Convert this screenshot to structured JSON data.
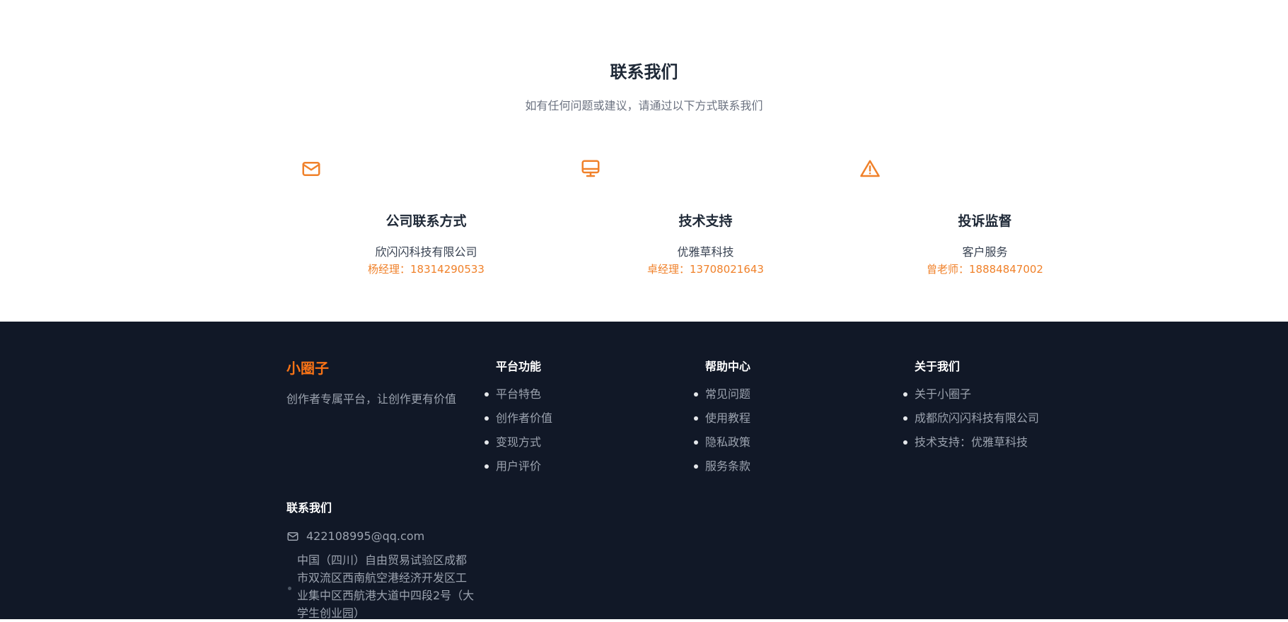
{
  "contact": {
    "title": "联系我们",
    "subtitle": "如有任何问题或建议，请通过以下方式联系我们",
    "accent_color": "#f0812a",
    "cards": [
      {
        "icon": "mail-icon",
        "title": "公司联系方式",
        "line": "欣闪闪科技有限公司",
        "phone": "杨经理：18314290533"
      },
      {
        "icon": "monitor-icon",
        "title": "技术支持",
        "line": "优雅草科技",
        "phone": "卓经理：13708021643"
      },
      {
        "icon": "alert-triangle-icon",
        "title": "投诉监督",
        "line": "客户服务",
        "phone": "曾老师：18884847002"
      }
    ]
  },
  "footer": {
    "background": "#111827",
    "brand": {
      "name": "小圈子",
      "slogan": "创作者专属平台，让创作更有价值",
      "color": "#f97316"
    },
    "columns": [
      {
        "title": "平台功能",
        "items": [
          "平台特色",
          "创作者价值",
          "变现方式",
          "用户评价"
        ]
      },
      {
        "title": "帮助中心",
        "items": [
          "常见问题",
          "使用教程",
          "隐私政策",
          "服务条款"
        ]
      },
      {
        "title": "关于我们",
        "items": [
          "关于小圈子",
          "成都欣闪闪科技有限公司",
          "技术支持：优雅草科技"
        ]
      }
    ],
    "contact": {
      "title": "联系我们",
      "email": "422108995@qq.com",
      "address": "中国（四川）自由贸易试验区成都市双流区西南航空港经济开发区工业集中区西航港大道中四段2号（大学生创业园）"
    }
  }
}
